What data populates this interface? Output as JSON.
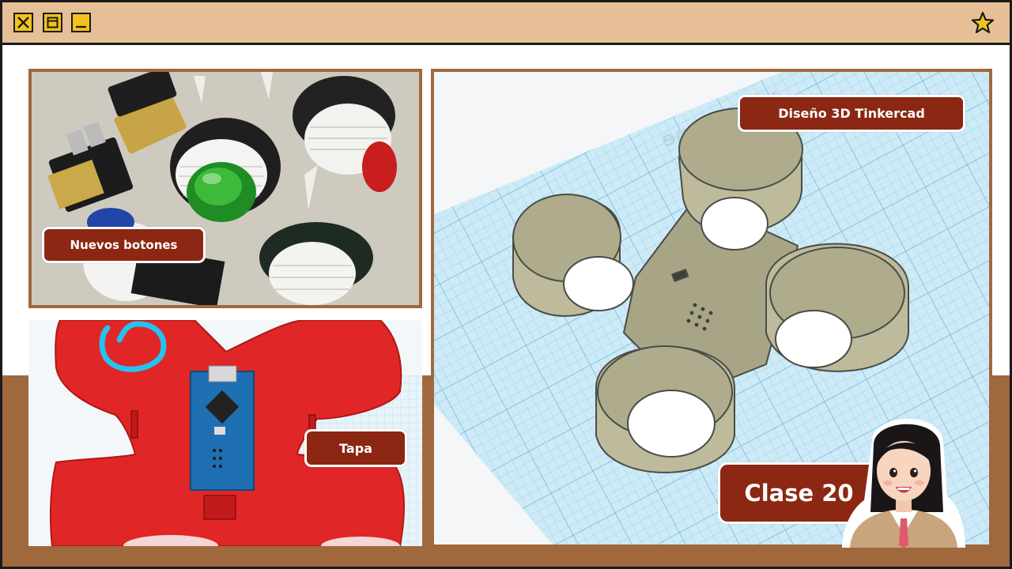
{
  "window": {
    "controls": [
      {
        "name": "close",
        "icon": "close-icon"
      },
      {
        "name": "restore",
        "icon": "restore-icon"
      },
      {
        "name": "minimize",
        "icon": "minimize-icon"
      }
    ],
    "star_icon": "star-icon"
  },
  "labels": {
    "nuevos_botones": "Nuevos botones",
    "tapa": "Tapa",
    "diseno": "Diseño 3D Tinkercad",
    "clase": "Clase 20"
  },
  "colors": {
    "titlebar": "#e6bf96",
    "accent_brown": "#a0683d",
    "tag_red": "#8b2712",
    "button_yellow": "#f3c21a",
    "model_khaki": "#b8b696",
    "grid_blue": "#bfe3f2"
  }
}
